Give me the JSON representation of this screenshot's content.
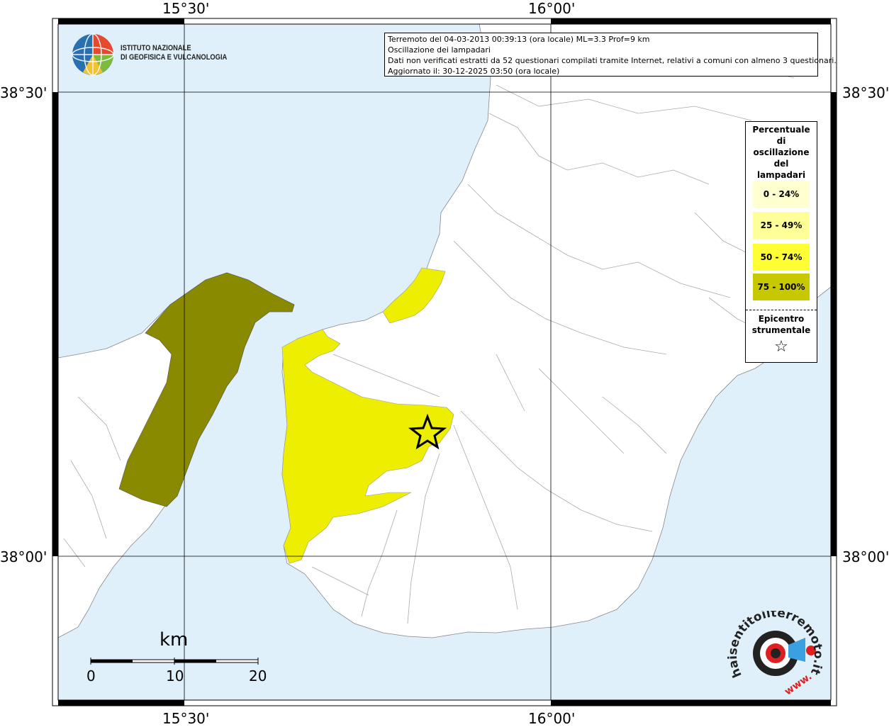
{
  "map": {
    "top_longitudes": [
      "15°30'",
      "16°00'"
    ],
    "bottom_longitudes": [
      "15°30'",
      "16°00'"
    ],
    "left_latitudes": [
      "38°30'",
      "38°00'"
    ],
    "right_latitudes": [
      "38°30'",
      "38°00'"
    ],
    "colors": {
      "sea": "#dff0fb",
      "land": "#ffffff",
      "class_0_24": "#ffffd0",
      "class_25_49": "#ffff99",
      "class_50_74": "#ffff33",
      "class_75_100": "#c8c800",
      "map_class_50_74": "#eeee00",
      "map_class_75_100": "#8a8a00"
    }
  },
  "info": {
    "line1": "Terremoto del 04-03-2013 00:39:13 (ora locale) ML=3.3 Prof=9 km",
    "line2": "Oscillazione dei lampadari",
    "line3": "Dati non verificati estratti da 52 questionari compilati tramite Internet, relativi a comuni con almeno 3 questionari.",
    "line4": "Aggiornato il: 30-12-2025 03:50 (ora locale)"
  },
  "legend": {
    "title_lines": [
      "Percentuale",
      "di",
      "oscillazione",
      "del",
      "lampadari"
    ],
    "classes": [
      "0 - 24%",
      "25 - 49%",
      "50 - 74%",
      "75 - 100%"
    ],
    "epicenter_lines": [
      "Epicentro",
      "strumentale"
    ],
    "epicenter_symbol": "☆"
  },
  "logo": {
    "line1": "ISTITUTO NAZIONALE",
    "line2": "DI GEOFISICA E VULCANOLOGIA"
  },
  "scalebar": {
    "unit": "km",
    "labels": [
      "0",
      "10",
      "20"
    ]
  },
  "hst_logo": {
    "text_main": "haisentitoilterremoto.it",
    "text_www": "www.",
    "icon": "megaphone-icon"
  }
}
